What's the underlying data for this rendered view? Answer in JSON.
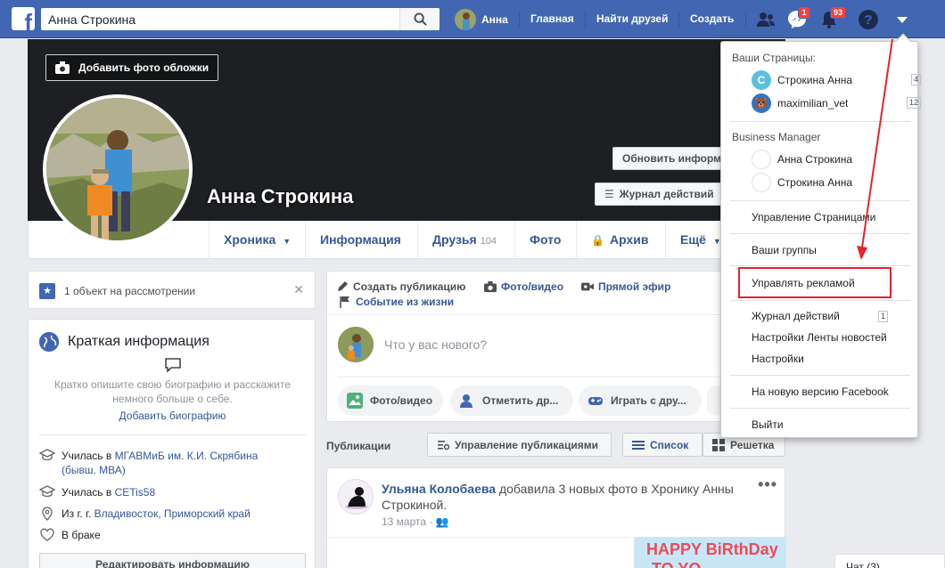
{
  "header": {
    "search_value": "Анна Строкина",
    "user_name": "Анна",
    "nav_home": "Главная",
    "nav_friends": "Найти друзей",
    "nav_create": "Создать",
    "messages_badge": "1",
    "notifications_badge": "93",
    "brand_color": "#4267b2"
  },
  "cover": {
    "add_cover_label": "Добавить фото обложки",
    "name": "Анна Строкина",
    "update_info_label": "Обновить информ",
    "activity_log_label": "Журнал действий"
  },
  "tabs": [
    {
      "label": "Хроника",
      "caret": "▼"
    },
    {
      "label": "Информация"
    },
    {
      "label": "Друзья",
      "count": "104"
    },
    {
      "label": "Фото"
    },
    {
      "label": "Архив"
    },
    {
      "label": "Ещё",
      "caret": "▼"
    }
  ],
  "review": {
    "text": "1 объект на рассмотрении",
    "close": "✕"
  },
  "intro": {
    "title": "Краткая информация",
    "description": "Кратко опишите свою биографию и расскажите немного больше о себе.",
    "add_bio": "Добавить биографию",
    "rows": [
      {
        "icon": "education-icon",
        "prefix": "Училась в ",
        "link": "МГАВМиБ им. К.И. Скрябина (бывш. МВА)"
      },
      {
        "icon": "education-icon",
        "prefix": "Училась в ",
        "link": "CETis58"
      },
      {
        "icon": "location-icon",
        "prefix": "Из г. г. ",
        "link": "Владивосток, Приморский край"
      },
      {
        "icon": "heart-icon",
        "prefix": "В браке",
        "link": ""
      }
    ],
    "edit_label": "Редактировать информацию"
  },
  "composer": {
    "tab_create": "Создать публикацию",
    "tab_photo": "Фото/видео",
    "tab_live": "Прямой эфир",
    "tab_event": "Событие из жизни",
    "placeholder": "Что у вас нового?",
    "pill_photo": "Фото/видео",
    "pill_tag": "Отметить др...",
    "pill_play": "Играть с дру..."
  },
  "publications": {
    "label": "Публикации",
    "manage": "Управление публикациями",
    "list": "Список",
    "grid": "Решетка"
  },
  "post": {
    "author": "Ульяна Колобаева",
    "action": " добавила 3 новых фото в Хронику Анны Строкиной.",
    "date": "13 марта · ",
    "more": "•••",
    "image_text_1": "HAPPY BiRthDay",
    "image_text_2": "TO YO"
  },
  "dropdown": {
    "pages_head": "Ваши Страницы:",
    "pages": [
      {
        "initial": "С",
        "name": "Строкина Анна",
        "count": "4",
        "color": "#5bc0de"
      },
      {
        "initial": "🐻",
        "name": "maximilian_vet",
        "count": "12",
        "color": "#2f75c9"
      }
    ],
    "bm_head": "Business Manager",
    "bm_items": [
      "Анна Строкина",
      "Строкина Анна"
    ],
    "manage_pages": "Управление Страницами",
    "groups": "Ваши группы",
    "manage_ads": "Управлять рекламой",
    "activity_log": "Журнал действий",
    "activity_count": "1",
    "news_feed": "Настройки Ленты новостей",
    "settings": "Настройки",
    "new_version": "На новую версию Facebook",
    "logout": "Выйти"
  },
  "chat": {
    "label": "Чат (3)"
  },
  "annotation_color": "#e8232a"
}
